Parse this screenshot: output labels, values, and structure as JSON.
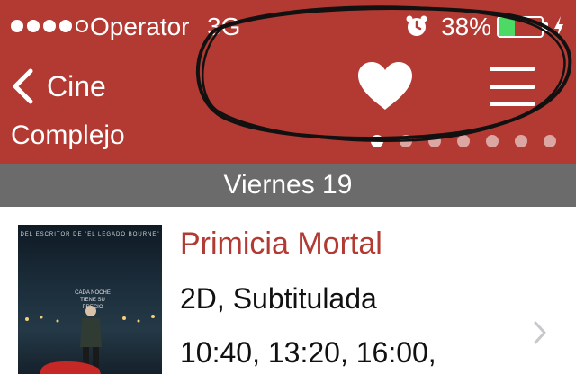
{
  "status_bar": {
    "carrier": "Operator",
    "network": "3G",
    "battery_percent": "38%",
    "battery_level": 0.38,
    "signal_bars_filled": 4,
    "signal_bars_total": 5
  },
  "nav": {
    "back_label": "Cine",
    "venue_label": "Complejo",
    "page_count": 7,
    "active_page": 1,
    "favorite_icon": "heart-icon",
    "menu_icon": "hamburger-menu-icon"
  },
  "date_header": "Viernes 19",
  "movie": {
    "title": "Primicia Mortal",
    "format": "2D, Subtitulada",
    "times": "10:40, 13:20, 16:00,"
  },
  "colors": {
    "brand_red": "#b23a33",
    "date_bar_gray": "#6b6b6b",
    "battery_green": "#4cd964"
  }
}
